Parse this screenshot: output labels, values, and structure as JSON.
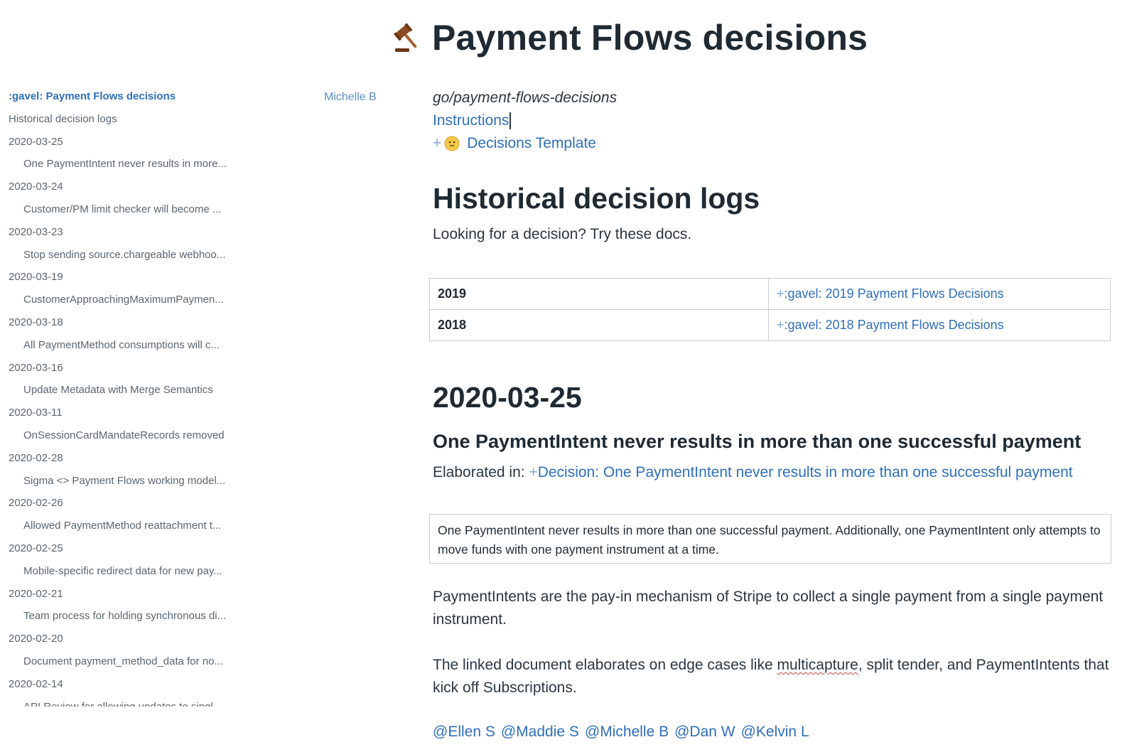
{
  "header": {
    "icon": "gavel-icon",
    "title": "Payment Flows decisions"
  },
  "outline": {
    "items": [
      {
        "label": ":gavel: Payment Flows decisions",
        "level": "h1",
        "active": true
      },
      {
        "label": "Historical decision logs",
        "level": "h2"
      },
      {
        "label": "2020-03-25",
        "level": "h2"
      },
      {
        "label": "One PaymentIntent never results in more...",
        "level": "h3"
      },
      {
        "label": "2020-03-24",
        "level": "h2"
      },
      {
        "label": "Customer/PM limit checker will become ...",
        "level": "h3"
      },
      {
        "label": "2020-03-23",
        "level": "h2"
      },
      {
        "label": "Stop sending source.chargeable webhoo...",
        "level": "h3"
      },
      {
        "label": "2020-03-19",
        "level": "h2"
      },
      {
        "label": "CustomerApproachingMaximumPaymen...",
        "level": "h3"
      },
      {
        "label": "2020-03-18",
        "level": "h2"
      },
      {
        "label": "All PaymentMethod consumptions will c...",
        "level": "h3"
      },
      {
        "label": "2020-03-16",
        "level": "h2"
      },
      {
        "label": "Update Metadata with Merge Semantics",
        "level": "h3"
      },
      {
        "label": "2020-03-11",
        "level": "h2"
      },
      {
        "label": "OnSessionCardMandateRecords removed",
        "level": "h3"
      },
      {
        "label": "2020-02-28",
        "level": "h2"
      },
      {
        "label": "Sigma <> Payment Flows working model...",
        "level": "h3"
      },
      {
        "label": "2020-02-26",
        "level": "h2"
      },
      {
        "label": "Allowed PaymentMethod reattachment t...",
        "level": "h3"
      },
      {
        "label": "2020-02-25",
        "level": "h2"
      },
      {
        "label": "Mobile-specific redirect data for new pay...",
        "level": "h3"
      },
      {
        "label": "2020-02-21",
        "level": "h2"
      },
      {
        "label": "Team process for holding synchronous di...",
        "level": "h3"
      },
      {
        "label": "2020-02-20",
        "level": "h2"
      },
      {
        "label": "Document payment_method_data for no...",
        "level": "h3"
      },
      {
        "label": "2020-02-14",
        "level": "h2"
      },
      {
        "label": "API Review for allowing updates to singl...",
        "level": "h3"
      }
    ]
  },
  "author": "Michelle B",
  "doc": {
    "short_link": "go/payment-flows-decisions",
    "instructions": "Instructions",
    "template_plus": "+",
    "template_icon": "smiley-face-icon",
    "template_link": "Decisions Template",
    "historical_heading": "Historical decision logs",
    "historical_desc": "Looking for a decision? Try these docs.",
    "years": [
      {
        "year": "2019",
        "plus": "+",
        "link": ":gavel: 2019 Payment Flows Decisions"
      },
      {
        "year": "2018",
        "plus": "+",
        "link": ":gavel: 2018 Payment Flows Decisions"
      }
    ],
    "date_heading": "2020-03-25",
    "decision_heading": "One PaymentIntent never results in more than one successful payment",
    "elaborated_prefix": "Elaborated in:",
    "elaborated_plus": "+",
    "elaborated_link": "Decision: One PaymentIntent never results in more than one successful payment",
    "callout": "One PaymentIntent never results in more than one successful payment. Additionally, one PaymentIntent only attempts to move funds with one payment instrument at a time.",
    "para1": "PaymentIntents are the pay-in mechanism of Stripe to collect a single payment from a single payment instrument.",
    "para2_before": "The linked document elaborates on edge cases like ",
    "para2_misspelled": "multicapture",
    "para2_after": ", split tender, and PaymentIntents that kick off Subscriptions.",
    "mentions": [
      "@Ellen S",
      "@Maddie S",
      "@Michelle B",
      "@Dan W",
      "@Kelvin L"
    ]
  },
  "colors": {
    "link": "#2f6fba",
    "text": "#1f2a33",
    "muted": "#5b6670",
    "border": "#c9ced3",
    "spellcheck": "#d8413a"
  }
}
